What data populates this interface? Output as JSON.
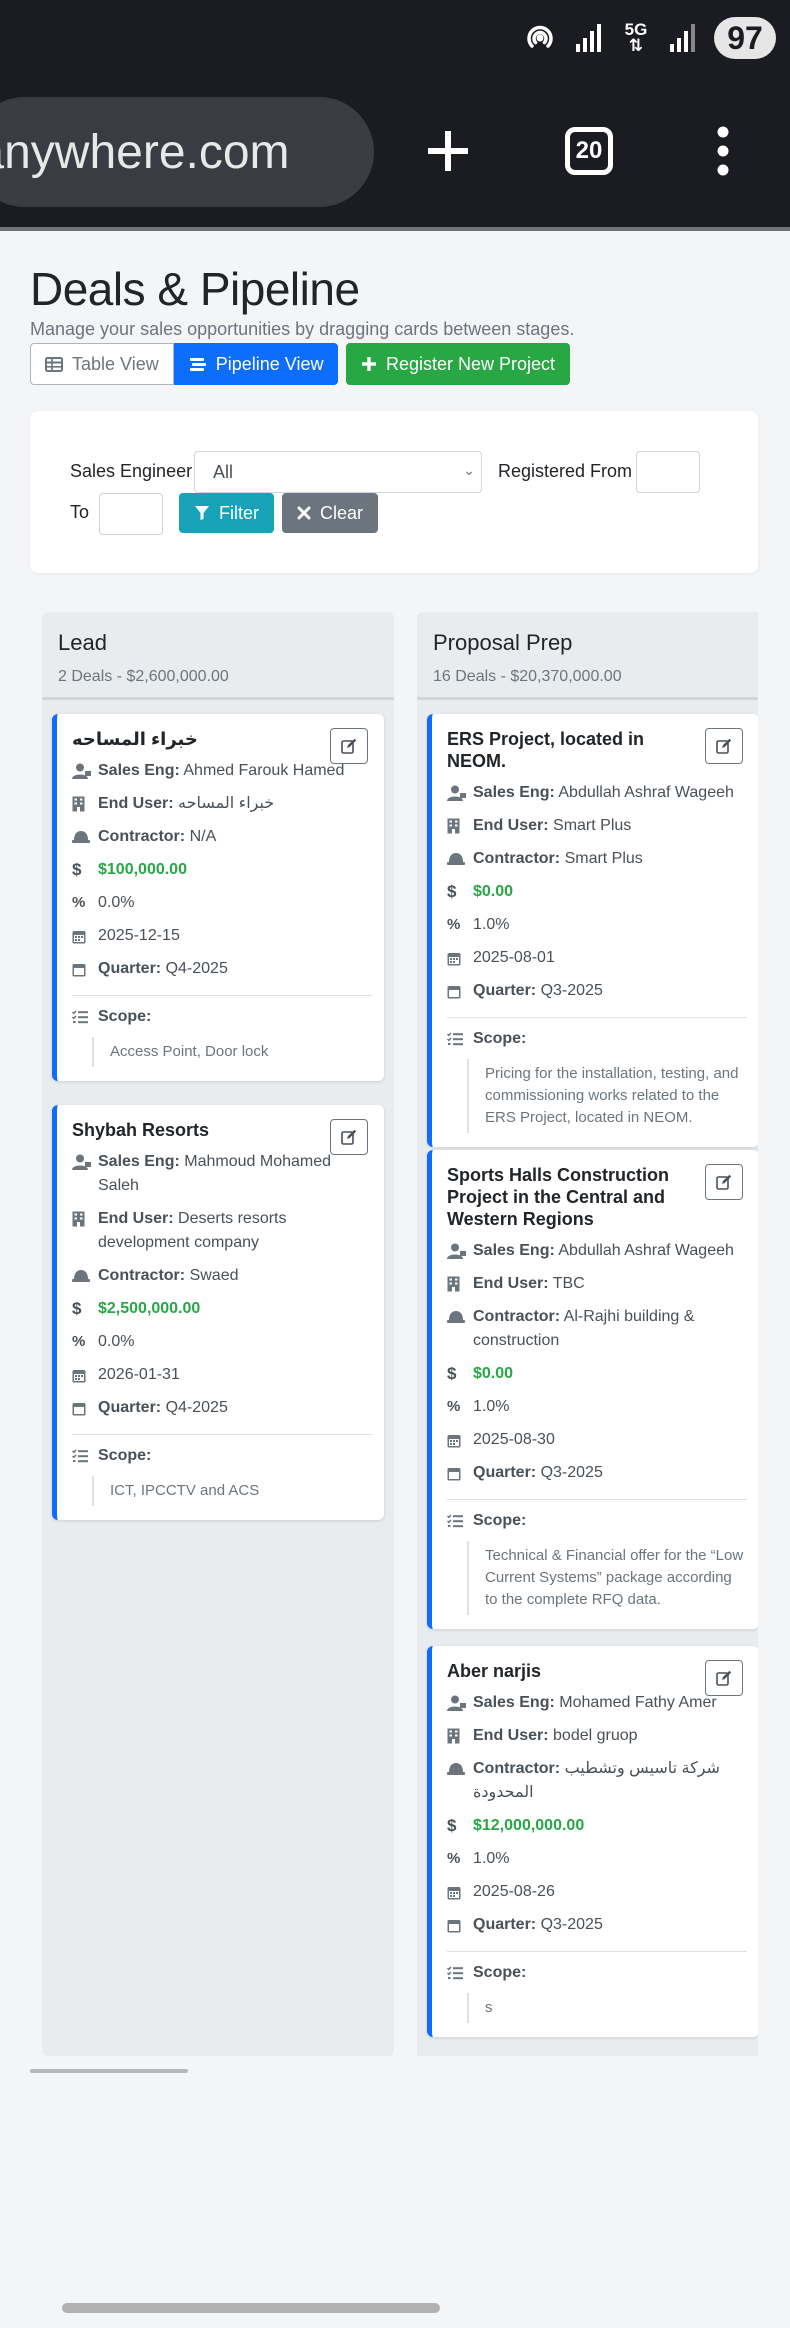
{
  "status_bar": {
    "battery": "97",
    "network": "5G"
  },
  "browser": {
    "url": "onanywhere.com",
    "tab_count": "20"
  },
  "page": {
    "title": "Deals & Pipeline",
    "subtitle": "Manage your sales opportunities by dragging cards between stages.",
    "table_view_label": "Table View",
    "pipeline_view_label": "Pipeline View",
    "register_label": "Register New Project"
  },
  "filters": {
    "sales_engineer_label": "Sales Engineer",
    "sales_engineer_value": "All",
    "registered_from_label": "Registered From",
    "to_label": "To",
    "filter_label": "Filter",
    "clear_label": "Clear"
  },
  "labels": {
    "sales_eng": "Sales Eng:",
    "end_user": "End User:",
    "contractor": "Contractor:",
    "quarter": "Quarter:",
    "scope": "Scope:"
  },
  "columns": [
    {
      "title": "Lead",
      "meta": "2 Deals - $2,600,000.00",
      "cards": [
        {
          "title": "خبراء المساحه",
          "sales_eng": "Ahmed Farouk Hamed",
          "end_user": "خبراء المساحه",
          "contractor": "N/A",
          "amount": "$100,000.00",
          "probability": "0.0%",
          "date": "2025-12-15",
          "quarter": "Q4-2025",
          "scope": "Access Point, Door lock"
        },
        {
          "title": "Shybah Resorts",
          "sales_eng": "Mahmoud Mohamed Saleh",
          "end_user": "Deserts resorts development company",
          "contractor": "Swaed",
          "amount": "$2,500,000.00",
          "probability": "0.0%",
          "date": "2026-01-31",
          "quarter": "Q4-2025",
          "scope": "ICT, IPCCTV and ACS"
        }
      ]
    },
    {
      "title": "Proposal Prep",
      "meta": "16 Deals - $20,370,000.00",
      "cards": [
        {
          "title": "ERS Project, located in NEOM.",
          "sales_eng": "Abdullah Ashraf Wageeh",
          "end_user": "Smart Plus",
          "contractor": "Smart Plus",
          "amount": "$0.00",
          "probability": "1.0%",
          "date": "2025-08-01",
          "quarter": "Q3-2025",
          "scope": "Pricing for the installation, testing, and commissioning works related to the ERS Project, located in NEOM."
        },
        {
          "title": "Sports Halls Construction Project in the Central and Western Regions",
          "sales_eng": "Abdullah Ashraf Wageeh",
          "end_user": "TBC",
          "contractor": "Al-Rajhi building & construction",
          "amount": "$0.00",
          "probability": "1.0%",
          "date": "2025-08-30",
          "quarter": "Q3-2025",
          "scope": "Technical & Financial offer for the “Low Current Systems” package according to the complete RFQ data."
        },
        {
          "title": "Aber narjis",
          "sales_eng": "Mohamed Fathy Amer",
          "end_user": "bodel gruop",
          "contractor": "شركة تاسيس وتشطيب المحدودة",
          "amount": "$12,000,000.00",
          "probability": "1.0%",
          "date": "2025-08-26",
          "quarter": "Q3-2025",
          "scope": "s"
        }
      ]
    }
  ]
}
